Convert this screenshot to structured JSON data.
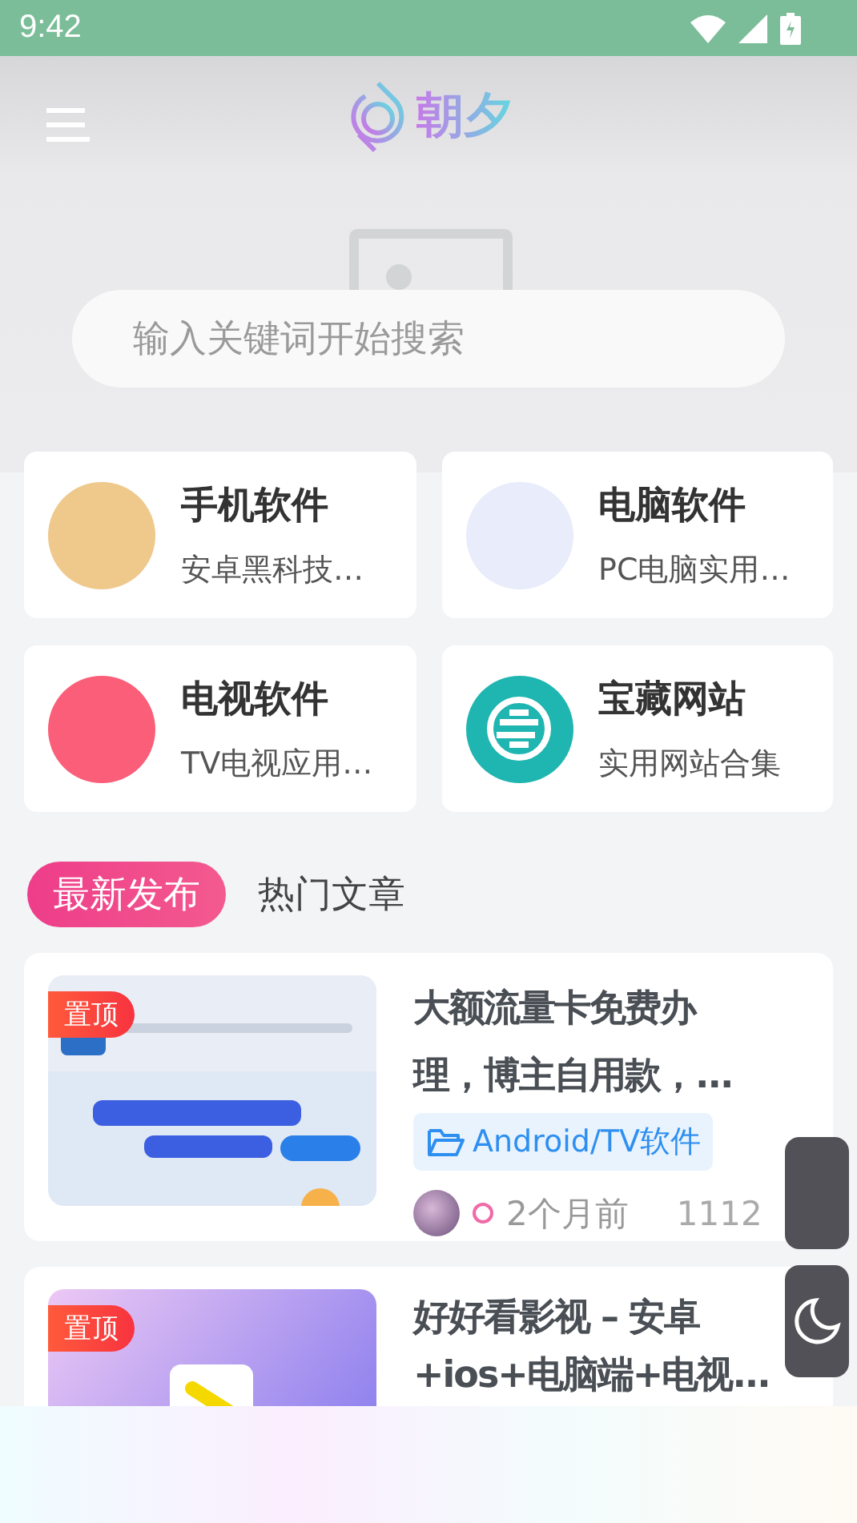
{
  "status_bar": {
    "time": "9:42"
  },
  "header": {
    "logo": "朝夕"
  },
  "search": {
    "placeholder": "输入关键词开始搜索"
  },
  "categories": [
    {
      "title": "手机软件",
      "subtitle": "安卓黑科技…",
      "color": "#efc88c",
      "kind": "plain"
    },
    {
      "title": "电脑软件",
      "subtitle": "PC电脑实用…",
      "color": "#e8ecfb",
      "kind": "plain"
    },
    {
      "title": "电视软件",
      "subtitle": "TV电视应用…",
      "color": "#fb5e78",
      "kind": "plain"
    },
    {
      "title": "宝藏网站",
      "subtitle": "实用网站合集",
      "color": "#1fb5b0",
      "kind": "emblem"
    }
  ],
  "tabs": [
    {
      "label": "最新发布",
      "selected": true
    },
    {
      "label": "热门文章",
      "selected": false
    }
  ],
  "posts": [
    {
      "badge": "置顶",
      "title_lines": [
        "大额流量卡免费办",
        "理，博主自用款，..."
      ],
      "tag": "Android/TV软件",
      "time": "2个月前",
      "views": "1112"
    },
    {
      "badge": "置顶",
      "title_lines": [
        "好好看影视 – 安卓",
        "+ios+电脑端+电视..."
      ]
    }
  ]
}
